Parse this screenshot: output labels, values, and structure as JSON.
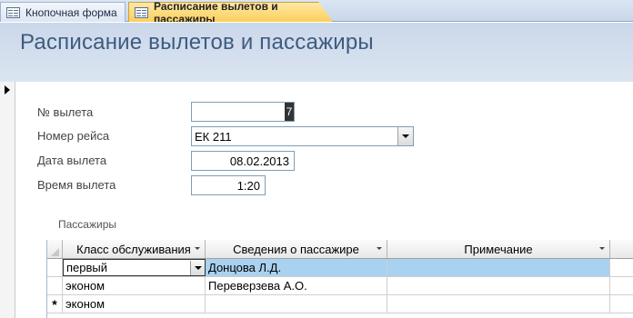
{
  "tabs": [
    {
      "label": "Кнопочная форма"
    },
    {
      "label": "Расписание вылетов и пассажиры"
    }
  ],
  "header": {
    "title": "Расписание вылетов и пассажиры"
  },
  "form": {
    "flight_no": {
      "label": "№ вылета",
      "value": "7"
    },
    "route_no": {
      "label": "Номер рейса",
      "value": "ЕК 211"
    },
    "date": {
      "label": "Дата вылета",
      "value": "08.02.2013"
    },
    "time": {
      "label": "Время вылета",
      "value": "1:20"
    }
  },
  "subform": {
    "title": "Пассажиры",
    "columns": [
      "Класс обслуживания",
      "Сведения о пассажире",
      "Примечание"
    ],
    "rows": [
      {
        "class": "первый",
        "passenger": "Донцова Л.Д.",
        "note": ""
      },
      {
        "class": "эконом",
        "passenger": "Переверзева А.О.",
        "note": ""
      }
    ],
    "new_row": {
      "class": "эконом",
      "marker": "*"
    }
  },
  "colors": {
    "header_bg": "#cbd8ea",
    "active_tab": "#fbcf5a",
    "selection": "#a9d1f0"
  }
}
